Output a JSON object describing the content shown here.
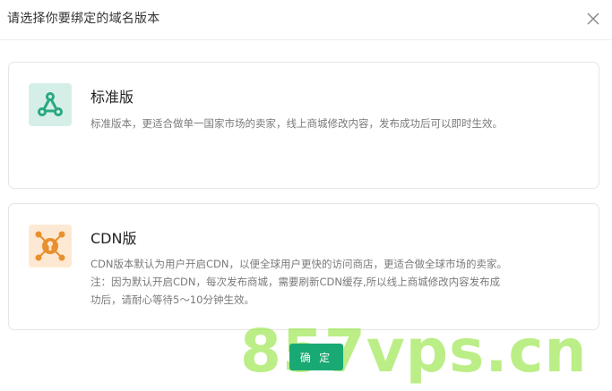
{
  "dialog": {
    "title": "请选择你要绑定的域名版本",
    "close_icon": "close-icon"
  },
  "options": [
    {
      "icon": "share-network-icon",
      "icon_color": "#2aa87e",
      "title": "标准版",
      "description": "标准版本，更适合做单一国家市场的卖家，线上商城修改内容，发布成功后可以即时生效。"
    },
    {
      "icon": "cdn-network-icon",
      "icon_color": "#e8902e",
      "title": "CDN版",
      "description_lines": [
        "CDN版本默认为用户开启CDN，以便全球用户更快的访问商店，更适合做全球市场的卖家。",
        "注：因为默认开启CDN，每次发布商城，需要刷新CDN缓存,所以线上商城修改内容发布成",
        "功后，请耐心等待5～10分钟生效。"
      ]
    }
  ],
  "footer": {
    "confirm_label": "确 定",
    "confirm_color": "#19a974"
  },
  "watermark": {
    "text": "857vps.cn",
    "color": "#92e43c"
  }
}
